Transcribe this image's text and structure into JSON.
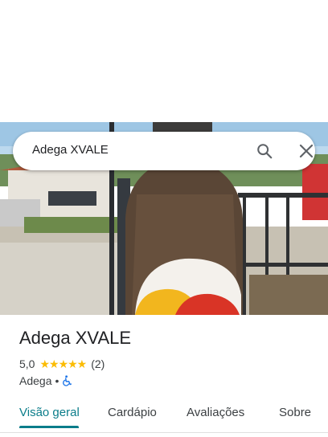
{
  "search": {
    "query": "Adega XVALE"
  },
  "place": {
    "name": "Adega XVALE",
    "rating": "5,0",
    "stars": "★★★★★",
    "review_count": "(2)",
    "category": "Adega",
    "separator": "•"
  },
  "tabs": [
    {
      "label": "Visão geral",
      "active": true
    },
    {
      "label": "Cardápio",
      "active": false
    },
    {
      "label": "Avaliações",
      "active": false
    },
    {
      "label": "Sobre",
      "active": false
    }
  ],
  "colors": {
    "accent": "#0b7d8a",
    "star": "#fbbc04",
    "accessible": "#1a73e8"
  },
  "icons": {
    "search": "search-icon",
    "close": "close-icon",
    "accessibility": "wheelchair-icon"
  }
}
